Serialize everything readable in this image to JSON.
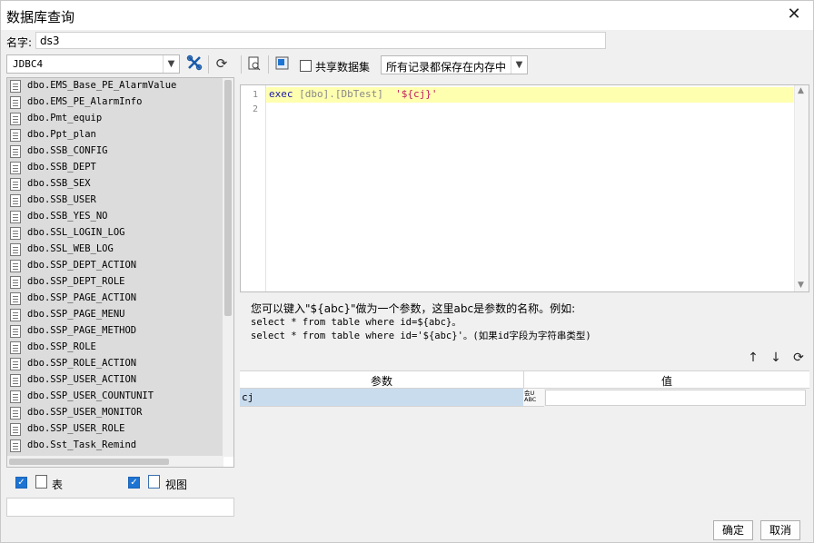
{
  "window": {
    "title": "数据库查询",
    "close_glyph": "✕"
  },
  "name": {
    "label": "名字:",
    "value": "ds3"
  },
  "left_panel": {
    "connection": "JDBC4",
    "tables": [
      "dbo.EMS_Base_PE_AlarmValue",
      "dbo.EMS_PE_AlarmInfo",
      "dbo.Pmt_equip",
      "dbo.Ppt_plan",
      "dbo.SSB_CONFIG",
      "dbo.SSB_DEPT",
      "dbo.SSB_SEX",
      "dbo.SSB_USER",
      "dbo.SSB_YES_NO",
      "dbo.SSL_LOGIN_LOG",
      "dbo.SSL_WEB_LOG",
      "dbo.SSP_DEPT_ACTION",
      "dbo.SSP_DEPT_ROLE",
      "dbo.SSP_PAGE_ACTION",
      "dbo.SSP_PAGE_MENU",
      "dbo.SSP_PAGE_METHOD",
      "dbo.SSP_ROLE",
      "dbo.SSP_ROLE_ACTION",
      "dbo.SSP_USER_ACTION",
      "dbo.SSP_USER_COUNTUNIT",
      "dbo.SSP_USER_MONITOR",
      "dbo.SSP_USER_ROLE",
      "dbo.Sst_Task_Remind"
    ],
    "filter_table_label": "表",
    "filter_view_label": "视图"
  },
  "right_panel": {
    "share_label": "共享数据集",
    "mode_value": "所有记录都保存在内存中",
    "editor": {
      "line_numbers": [
        "1",
        "2"
      ],
      "sql_keyword": "exec",
      "sql_object": "[dbo].[DbTest]",
      "sql_string": "'${cj}'"
    },
    "hint": {
      "line1": "您可以键入\"${abc}\"做为一个参数，这里abc是参数的名称。例如:",
      "line2": "select * from table where id=${abc}。",
      "line3": "select * from table where id='${abc}'。(如果id字段为字符串类型)"
    },
    "params": {
      "col_param": "参数",
      "col_value": "值",
      "rows": [
        {
          "name": "cj",
          "type_line1": "会U",
          "type_line2": "ABC",
          "value": ""
        }
      ]
    }
  },
  "footer": {
    "ok": "确定",
    "cancel": "取消"
  }
}
